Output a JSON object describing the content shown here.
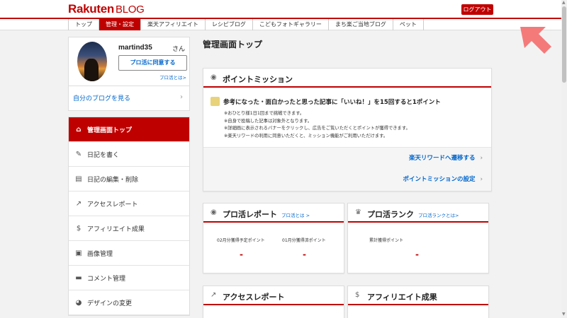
{
  "header": {
    "logo_main": "Rakuten",
    "logo_sub": "BLOG",
    "logout_label": "ログアウト"
  },
  "nav": {
    "tabs": [
      {
        "label": "トップ",
        "active": false
      },
      {
        "label": "管理・設定",
        "active": true
      },
      {
        "label": "楽天アフィリエイト",
        "active": false
      },
      {
        "label": "レシピブログ",
        "active": false
      },
      {
        "label": "こどもフォトギャラリー",
        "active": false
      },
      {
        "label": "まち楽ご当地ブログ",
        "active": false
      },
      {
        "label": "ペット",
        "active": false
      }
    ]
  },
  "profile": {
    "username": "martind35",
    "suffix": "さん",
    "pro_button": "プロ活に同意する",
    "pro_link": "プロ活とは>",
    "my_blog": "自分のブログを見る"
  },
  "sidebar": {
    "items": [
      {
        "label": "管理画面トップ",
        "icon": "home-icon",
        "active": true
      },
      {
        "label": "日記を書く",
        "icon": "pencil-icon",
        "active": false
      },
      {
        "label": "日記の編集・削除",
        "icon": "document-icon",
        "active": false
      },
      {
        "label": "アクセスレポート",
        "icon": "trend-icon",
        "active": false
      },
      {
        "label": "アフィリエイト成果",
        "icon": "money-bag-icon",
        "active": false
      },
      {
        "label": "画像管理",
        "icon": "image-icon",
        "active": false
      },
      {
        "label": "コメント管理",
        "icon": "comment-icon",
        "active": false
      },
      {
        "label": "デザインの変更",
        "icon": "palette-icon",
        "active": false
      }
    ]
  },
  "main": {
    "title": "管理画面トップ",
    "mission": {
      "title": "ポイントミッション",
      "headline": "参考になった・面白かったと思った記事に「いいね！」を15回すると1ポイント",
      "notes": [
        "※おひとり様1日1回まで挑戦できます。",
        "※自身で投稿した記事は対象外となります。",
        "※詳細画に表示されるバナーをクリックし、広告をご覧いただくとポイントが獲得できます。",
        "※楽天リワードの利用に同意いただくと、ミッション機能がご利用いただけます。"
      ],
      "link_reward": "楽天リワードへ遷移する",
      "link_settings": "ポイントミッションの設定"
    },
    "pro_report": {
      "title": "プロ活レポート",
      "link": "プロ活とは >",
      "label_feb": "02月分獲得予定ポイント",
      "label_jan": "01月分獲得済ポイント",
      "value_feb": "-",
      "value_jan": "-"
    },
    "pro_rank": {
      "title": "プロ活ランク",
      "link": "プロ活ランクとは>",
      "label_total": "累計獲得ポイント",
      "value_total": "-"
    },
    "access_report": {
      "title": "アクセスレポート"
    },
    "affiliate": {
      "title": "アフィリエイト成果"
    }
  },
  "colors": {
    "brand": "#bf0000",
    "link": "#0066cc"
  }
}
